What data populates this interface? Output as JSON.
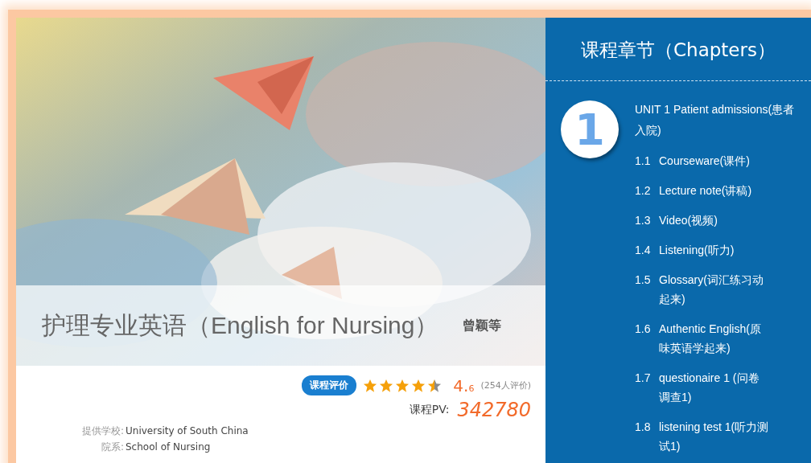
{
  "course": {
    "title": "护理专业英语（English for Nursing）",
    "authors": "曾颖等",
    "rating_badge": "课程评价",
    "stars": 4.5,
    "score_main": "4.",
    "score_decimal": "6",
    "rating_count": "(254人评价)",
    "pv_label": "课程PV:",
    "pv_value": "342780",
    "info": [
      {
        "label": "提供学校:",
        "value": "University of South China"
      },
      {
        "label": "院系:",
        "value": "School of Nursing"
      }
    ]
  },
  "chapters": {
    "title": "课程章节（Chapters）",
    "unit_number": "1",
    "unit_title": "UNIT 1 Patient admissions(患者入院)",
    "items": [
      {
        "number": "1.1",
        "label": "Courseware(课件)"
      },
      {
        "number": "1.2",
        "label": "Lecture note(讲稿)"
      },
      {
        "number": "1.3",
        "label": "Video(视频)"
      },
      {
        "number": "1.4",
        "label": "Listening(听力)"
      },
      {
        "number": "1.5",
        "label": "Glossary(词汇练习动起来)"
      },
      {
        "number": "1.6",
        "label": "Authentic English(原味英语学起来)"
      },
      {
        "number": "1.7",
        "label": "questionaire 1 (问卷调查1)"
      },
      {
        "number": "1.8",
        "label": "listening test 1(听力测试1)"
      }
    ]
  }
}
